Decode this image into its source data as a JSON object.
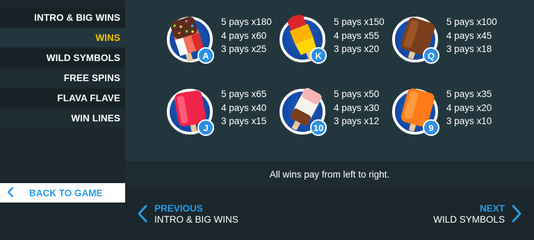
{
  "menu": {
    "items": [
      {
        "label": "INTRO & BIG WINS"
      },
      {
        "label": "WINS"
      },
      {
        "label": "WILD SYMBOLS"
      },
      {
        "label": "FREE SPINS"
      },
      {
        "label": "FLAVA FLAVE"
      },
      {
        "label": "WIN LINES"
      }
    ],
    "active": "WINS",
    "back_label": "BACK TO GAME"
  },
  "symbols": [
    {
      "letter": "A",
      "icon": "sprinkle-choc-ice-lolly",
      "pays": [
        "5 pays x180",
        "4 pays x60",
        "3 pays x25"
      ]
    },
    {
      "letter": "K",
      "icon": "rocket-ice-lolly",
      "pays": [
        "5 pays x150",
        "4 pays x55",
        "3 pays x20"
      ]
    },
    {
      "letter": "Q",
      "icon": "chocolate-ice-lolly",
      "pays": [
        "5 pays x100",
        "4 pays x45",
        "3 pays x18"
      ]
    },
    {
      "letter": "J",
      "icon": "pink-ice-lolly",
      "pays": [
        "5 pays x65",
        "4 pays x40",
        "3 pays x15"
      ]
    },
    {
      "letter": "10",
      "icon": "strawberry-choc-lolly",
      "pays": [
        "5 pays x50",
        "4 pays x30",
        "3 pays x12"
      ]
    },
    {
      "letter": "9",
      "icon": "orange-ice-lolly",
      "pays": [
        "5 pays x35",
        "4 pays x20",
        "3 pays x10"
      ]
    }
  ],
  "caption": "All wins pay from left to right.",
  "nav": {
    "prev": {
      "label": "PREVIOUS",
      "target": "INTRO & BIG WINS"
    },
    "next": {
      "label": "NEXT",
      "target": "WILD SYMBOLS"
    }
  },
  "colors": {
    "accent": "#2b9be8",
    "active": "#f5c400",
    "badge": "#1347a3"
  }
}
